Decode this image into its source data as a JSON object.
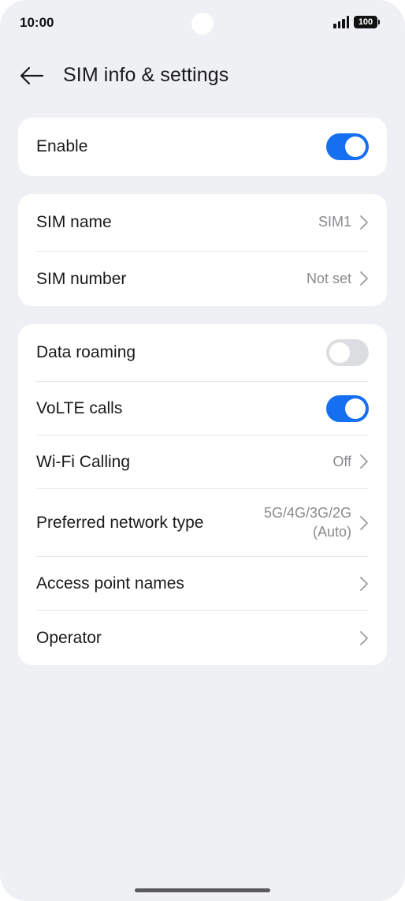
{
  "status_bar": {
    "time": "10:00",
    "battery_level": "100",
    "signal_bars": 4
  },
  "header": {
    "back_icon": "arrow-left-icon",
    "title": "SIM info & settings"
  },
  "card_enable": {
    "enable_label": "Enable",
    "enable_on": true
  },
  "card_sim": {
    "sim_name_label": "SIM name",
    "sim_name_value": "SIM1",
    "sim_number_label": "SIM number",
    "sim_number_value": "Not set"
  },
  "card_network": {
    "data_roaming_label": "Data roaming",
    "data_roaming_on": false,
    "volte_label": "VoLTE calls",
    "volte_on": true,
    "wifi_calling_label": "Wi-Fi Calling",
    "wifi_calling_value": "Off",
    "preferred_network_label": "Preferred network type",
    "preferred_network_value_line1": "5G/4G/3G/2G",
    "preferred_network_value_line2": "(Auto)",
    "apn_label": "Access point names",
    "operator_label": "Operator"
  },
  "colors": {
    "accent": "#1470f0",
    "background": "#eff0f3",
    "card": "#ffffff",
    "secondary_text": "#8a8a8f",
    "toggle_off": "#dcdde0"
  }
}
